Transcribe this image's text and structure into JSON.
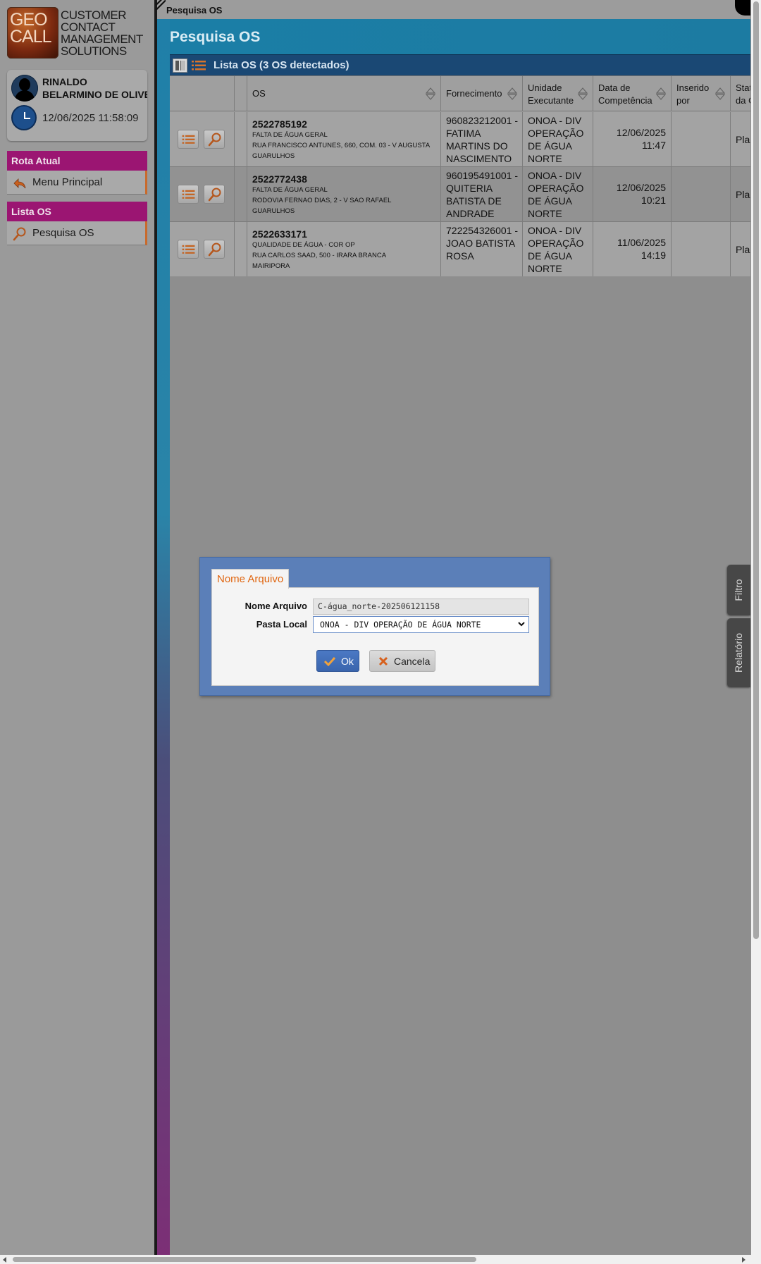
{
  "app": {
    "logo_box": [
      "GEO",
      "CALL"
    ],
    "logo_tagline": [
      "CUSTOMER",
      "CONTACT",
      "MANAGEMENT",
      "SOLUTIONS"
    ]
  },
  "user": {
    "name_line1": "RINALDO",
    "name_line2": "BELARMINO DE OLIVEI",
    "datetime": "12/06/2025 11:58:09"
  },
  "sidebar": {
    "groups": [
      {
        "header": "Rota Atual",
        "item": "Menu Principal",
        "icon": "back-arrow-icon"
      },
      {
        "header": "Lista OS",
        "item": "Pesquisa OS",
        "icon": "search-icon"
      }
    ]
  },
  "topbar": {
    "title": "Pesquisa OS"
  },
  "page": {
    "title": "Pesquisa OS"
  },
  "list": {
    "title": "Lista OS (3 OS detectados)",
    "columns": [
      "OS",
      "Fornecimento",
      "Unidade\nExecutante",
      "Data de\nCompetência",
      "Inserido\npor",
      "Status\nda OS"
    ],
    "rows": [
      {
        "os": "2522785192",
        "tipo": "FALTA DE ÁGUA GERAL",
        "endereco": "RUA FRANCISCO ANTUNES, 660, COM. 03 - V AUGUSTA",
        "cidade": "GUARULHOS",
        "fornecimento": "960823212001 - FATIMA MARTINS DO NASCIMENTO",
        "unidade": "ONOA - DIV OPERAÇÃO DE ÁGUA NORTE",
        "data": "12/06/2025",
        "hora": "11:47",
        "inserido": "",
        "status": "Planeja"
      },
      {
        "os": "2522772438",
        "tipo": "FALTA DE ÁGUA GERAL",
        "endereco": "RODOVIA FERNAO DIAS, 2 - V SAO RAFAEL",
        "cidade": "GUARULHOS",
        "fornecimento": "960195491001 - QUITERIA BATISTA DE ANDRADE",
        "unidade": "ONOA - DIV OPERAÇÃO DE ÁGUA NORTE",
        "data": "12/06/2025",
        "hora": "10:21",
        "inserido": "",
        "status": "Planeja"
      },
      {
        "os": "2522633171",
        "tipo": "QUALIDADE DE ÁGUA - COR OP",
        "endereco": "RUA CARLOS SAAD, 500 - IRARA BRANCA",
        "cidade": "MAIRIPORA",
        "fornecimento": "722254326001 - JOAO BATISTA ROSA",
        "unidade": "ONOA - DIV OPERAÇÃO DE ÁGUA NORTE",
        "data": "11/06/2025",
        "hora": "14:19",
        "inserido": "",
        "status": "Planeja"
      }
    ]
  },
  "side_tabs": {
    "filter": "Filtro",
    "report": "Relatório"
  },
  "dialog": {
    "tab": "Nome Arquivo",
    "filename_label": "Nome Arquivo",
    "filename_value": "C-água_norte-202506121158",
    "folder_label": "Pasta Local",
    "folder_value": "ONOA - DIV OPERAÇÃO DE ÁGUA NORTE",
    "ok_label": "Ok",
    "cancel_label": "Cancela"
  },
  "colors": {
    "accent_magenta": "#9b1572",
    "header_blue": "#1b7ea6",
    "list_bar_navy": "#1a4874",
    "dialog_blue": "#5b7fb8",
    "tab_orange": "#e0650f"
  }
}
